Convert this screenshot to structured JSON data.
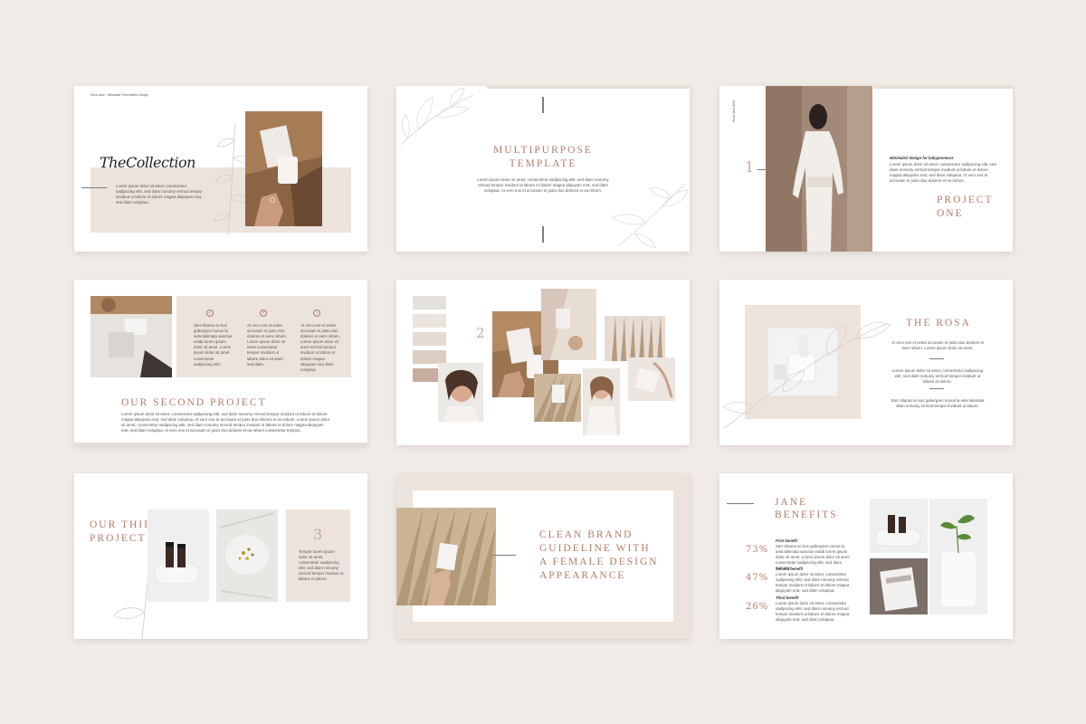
{
  "slide1": {
    "brand": "Rosa Jane - Minimalist Presentation Design",
    "script_title": "TheCollection",
    "body": "Lorem ipsum dolor sit amet, consectetur sadipscing elitr, sed diam nonumy eirmod tempor invidunt ut labore et dolore magna aliquyam erat, sed diam voluptua."
  },
  "slide2": {
    "title_line1": "Multipurpose",
    "title_line2": "Template",
    "body": "Lorem ipsum dolor sit amet, consectetur sadipscing elitr, sed diam nonumy eirmod tempor invidunt ut labore et dolore magna aliquyam erat, sed diam voluptua. At vero eos et accusam et justo duo dolores et ea rebum."
  },
  "slide3": {
    "side_text": "Rosa Jane 2024",
    "number": "1",
    "subtitle": "Minimalist design for babypreneurs",
    "body": "Lorem ipsum dolor sit amet, consectetur sadipscing elitr, sed diam nonumy eirmod tempor invidunt ut labore et dolore magna aliquyam erat, sed diam voluptua. At vero eos et accusam et justo duo dolores et ea rebum.",
    "title_line1": "Project",
    "title_line2": "One"
  },
  "slide4": {
    "col1": "Stet clitama so kus gubergren nonus la sela takimata sanctus estab lorem ipsum dolor sit amet. Lorem ipsum dolor sit amet consectetur sadipscing elitr.",
    "col2": "At vero eos et setas accusam et justo duo dolores et eam rebum. Lorem ipsum dolor sit amet consectetur tempor invidunt ut labore dolor sit amet sed diam.",
    "col3": "At vero eos et setas accusam et justo duo dolores et eam rebum. Lorem ipsum dolor sit amet eirmod tempor invidunt ut labore et dolore magna aliquyam sed diam voluptua.",
    "title": "Our Second Project",
    "body": "Lorem ipsum dolor sit amet, consectetur sadipscing elitr, sed diam nonumy eirmod tempor invidunt ut labore et dolore magna aliquyam erat, sed diam voluptua. At vero eos et accusam et justo duo dolores et ea rebum. Lorem ipsum dolor sit amet, consectetur sadipscing elitr, sed diam nonumy eirmod tempor invidunt ut labore et dolore magna aliquyam erat, sed diam voluptua. At vero eos et accusam et justo duo dolores et ea rebum consectetur tempos."
  },
  "slide5": {
    "number": "2",
    "swatches": [
      "#e4e0dc",
      "#ebe4de",
      "#e6dbd3",
      "#dccdc3",
      "#c6aea1"
    ]
  },
  "slide6": {
    "title": "The Rosa",
    "body1": "At vero eos et setas accusam et justo duo dolores et eam rebum. Lorem ipsum dolor sit amet.",
    "body2": "Lorem ipsum dolor sit amet, consectetur sadipscing elitr, sed diam nonumy eirmod tempor invidunt ut labore et dolore.",
    "body3": "Stet clitama so kus gubergren nonus la sela takimata diam nonumy eirmod tempor invidunt ut labore."
  },
  "slide7": {
    "title_line1": "Our Third",
    "title_line2": "Project",
    "number": "3",
    "body": "Tempor lorem ipsum dolor sit amet, consectetur sadipscing elitr, sed diam nonumy eirmod tempor invidunt ut labore et dolore."
  },
  "slide8": {
    "title_line1": "Clean Brand",
    "title_line2": "Guideline with",
    "title_line3": "a Female Design",
    "title_line4": "Appearance"
  },
  "slide9": {
    "title_line1": "Jane",
    "title_line2": "Benefits",
    "benefits": [
      {
        "percent": "73%",
        "label": "First benefit",
        "body": "Stet clitama so kus gubergren nonus la sela takimata sanctus estab lorem ipsum dolor sit amet. Lorem ipsum dolor sit amet consectetur sadipscing elitr, sed diam nonumy."
      },
      {
        "percent": "47%",
        "label": "Second benefit",
        "body": "Lorem ipsum dolor sit amet, consectetur sadipscing elitr, sed diam nonumy eirmod tempor invidunt ut labore et dolore magna aliquyam erat, sed diam voluptua."
      },
      {
        "percent": "26%",
        "label": "Third benefit",
        "body": "Lorem ipsum dolor sit amet, consectetur sadipscing elitr, sed diam nonumy eirmod tempor invidunt ut labore et dolore magna aliquyam erat, sed diam voluptua."
      }
    ]
  },
  "colors": {
    "background": "#f0ebe7",
    "accent": "#b07c68",
    "beige_block": "#ece3dd"
  }
}
